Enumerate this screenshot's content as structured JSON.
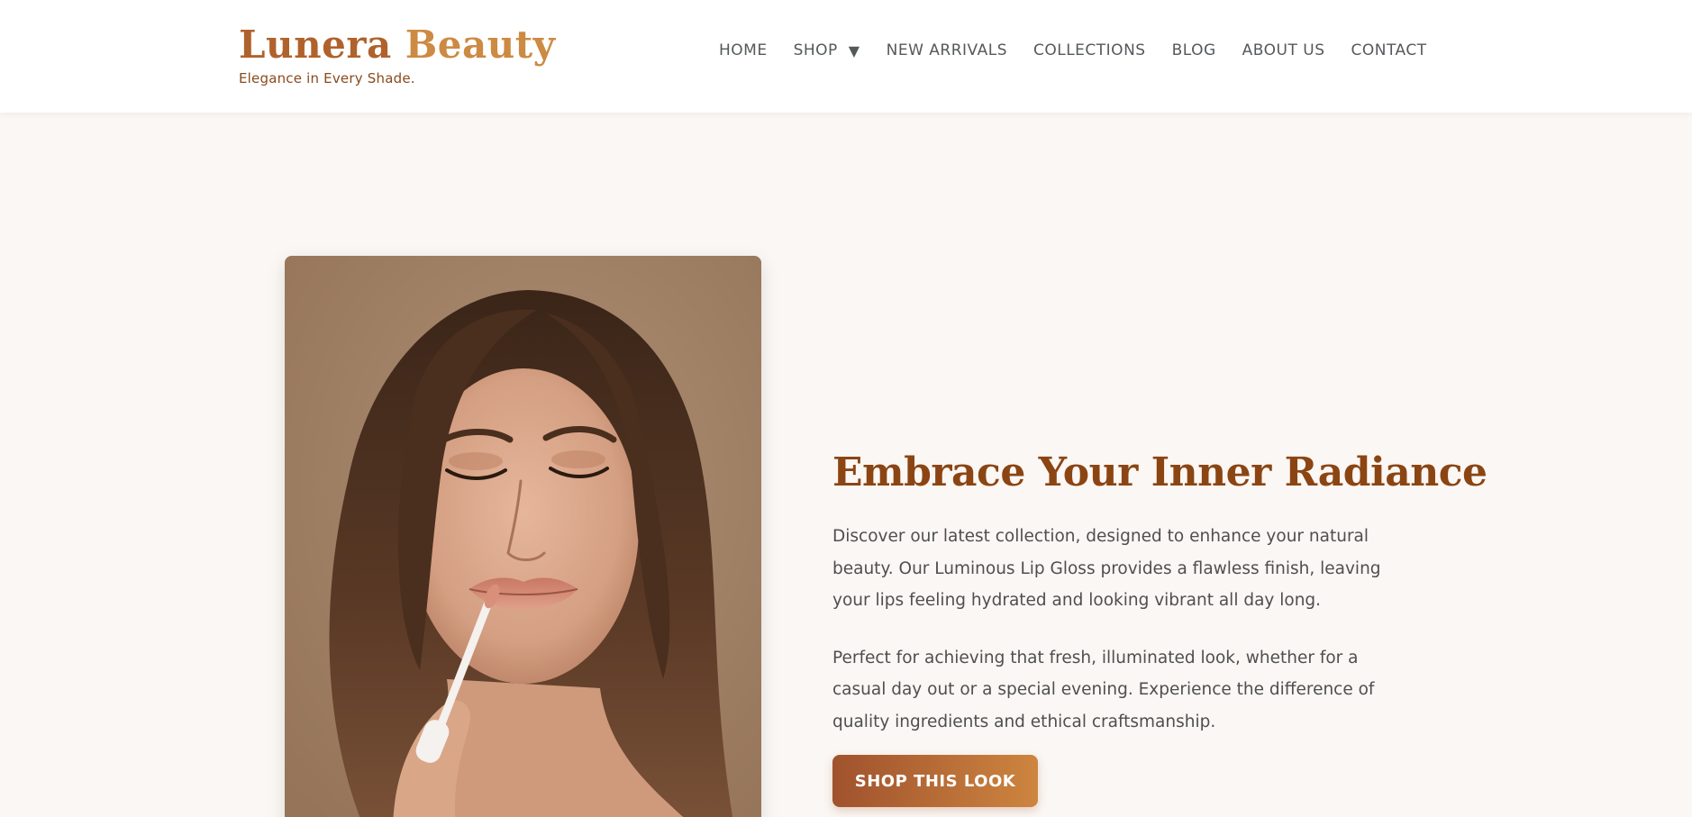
{
  "brand": {
    "name_part1": "Lunera ",
    "name_part2": "Beauty",
    "tagline": "Elegance in Every Shade."
  },
  "nav": {
    "items": [
      {
        "label": "HOME"
      },
      {
        "label": "SHOP"
      },
      {
        "label": "NEW ARRIVALS"
      },
      {
        "label": "COLLECTIONS"
      },
      {
        "label": "BLOG"
      },
      {
        "label": "ABOUT US"
      },
      {
        "label": "CONTACT"
      }
    ],
    "shop_caret": "▼"
  },
  "hero": {
    "image_icon": "portrait-lip-gloss-photo",
    "title": "Embrace Your Inner Radiance",
    "paragraph1": "Discover our latest collection, designed to enhance your natural beauty. Our Luminous Lip Gloss provides a flawless finish, leaving your lips feeling hydrated and looking vibrant all day long.",
    "paragraph2": "Perfect for achieving that fresh, illuminated look, whether for a casual day out or a special evening. Experience the difference of quality ingredients and ethical craftsmanship.",
    "cta_label": "SHOP THIS LOOK"
  },
  "colors": {
    "background": "#fbf7f4",
    "header_bg": "#ffffff",
    "brand": "#b0622c",
    "heading": "#8b4513",
    "cta_start": "#a0522d",
    "cta_end": "#cd853f"
  }
}
